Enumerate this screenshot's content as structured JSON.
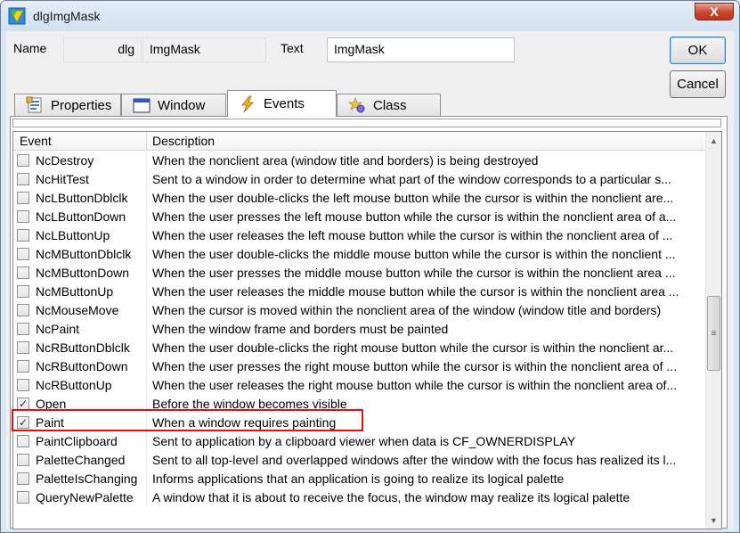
{
  "window": {
    "title": "dlgImgMask",
    "close_label": "X"
  },
  "form": {
    "name_label": "Name",
    "name_prefix": "dlg",
    "name_value": "ImgMask",
    "text_label": "Text",
    "text_value": "ImgMask"
  },
  "buttons": {
    "ok": "OK",
    "cancel": "Cancel"
  },
  "tabs": [
    {
      "label": "Properties",
      "icon": "properties-icon"
    },
    {
      "label": "Window",
      "icon": "window-icon"
    },
    {
      "label": "Events",
      "icon": "lightning-icon",
      "active": true
    },
    {
      "label": "Class",
      "icon": "class-icon"
    }
  ],
  "grid": {
    "columns": [
      "Event",
      "Description"
    ],
    "rows": [
      {
        "name": "NcDestroy",
        "checked": false,
        "desc": "When the nonclient area (window title and borders) is being destroyed"
      },
      {
        "name": "NcHitTest",
        "checked": false,
        "desc": "Sent to a window in order to determine what part of the window corresponds to a particular s..."
      },
      {
        "name": "NcLButtonDblclk",
        "checked": false,
        "desc": "When the user double-clicks the left mouse button while the cursor is within the nonclient are..."
      },
      {
        "name": "NcLButtonDown",
        "checked": false,
        "desc": "When the user presses the left mouse button while the cursor is within the nonclient area of a..."
      },
      {
        "name": "NcLButtonUp",
        "checked": false,
        "desc": "When the user releases the left mouse button while the cursor is within the nonclient area of ..."
      },
      {
        "name": "NcMButtonDblclk",
        "checked": false,
        "desc": "When the user double-clicks the middle mouse button while the cursor is within the nonclient ..."
      },
      {
        "name": "NcMButtonDown",
        "checked": false,
        "desc": "When the user presses the middle mouse button while the cursor is within the nonclient area ..."
      },
      {
        "name": "NcMButtonUp",
        "checked": false,
        "desc": "When the user releases the middle mouse button while the cursor is within the nonclient area ..."
      },
      {
        "name": "NcMouseMove",
        "checked": false,
        "desc": "When the cursor is moved within the nonclient area of the window (window title and borders)"
      },
      {
        "name": "NcPaint",
        "checked": false,
        "desc": "When the window frame and borders must be painted"
      },
      {
        "name": "NcRButtonDblclk",
        "checked": false,
        "desc": "When the user double-clicks the right mouse button while the cursor is within the nonclient ar..."
      },
      {
        "name": "NcRButtonDown",
        "checked": false,
        "desc": "When the user presses the right mouse button while the cursor is within the nonclient area of ..."
      },
      {
        "name": "NcRButtonUp",
        "checked": false,
        "desc": "When the user releases the right mouse button while the cursor is within the nonclient area of..."
      },
      {
        "name": "Open",
        "checked": true,
        "desc": "Before the window becomes visible"
      },
      {
        "name": "Paint",
        "checked": true,
        "desc": "When a window requires painting"
      },
      {
        "name": "PaintClipboard",
        "checked": false,
        "desc": "Sent to application by a clipboard viewer when data is CF_OWNERDISPLAY"
      },
      {
        "name": "PaletteChanged",
        "checked": false,
        "desc": "Sent to all top-level and overlapped windows after the window with the focus has realized its l..."
      },
      {
        "name": "PaletteIsChanging",
        "checked": false,
        "desc": "Informs applications that an application is going to realize its logical palette"
      },
      {
        "name": "QueryNewPalette",
        "checked": false,
        "desc": "A window that it is about to receive the focus, the window may realize its logical palette"
      }
    ]
  },
  "colors": {
    "highlight_border": "#e01010",
    "window_frame": "#dbe6f3"
  }
}
